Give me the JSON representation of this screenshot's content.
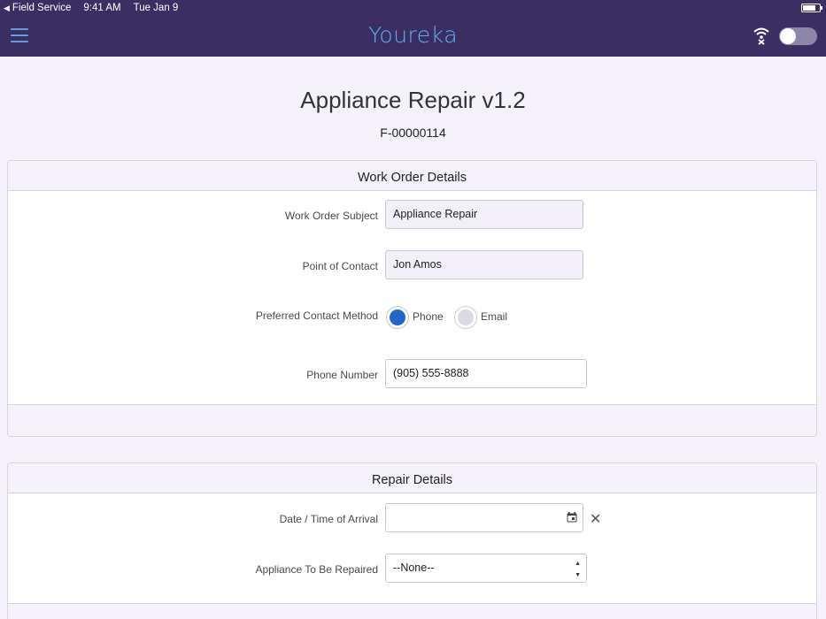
{
  "status_bar": {
    "back_app": "Field Service",
    "time": "9:41 AM",
    "date": "Tue Jan 9",
    "battery_level": 0.7
  },
  "nav": {
    "brand": "Youreka",
    "menu_icon": "hamburger-icon",
    "wifi_icon": "wifi-off-icon",
    "offline_toggle_on": false
  },
  "form": {
    "title": "Appliance Repair v1.2",
    "id": "F-00000114"
  },
  "work_order": {
    "header": "Work Order Details",
    "subject_label": "Work Order Subject",
    "subject_value": "Appliance Repair",
    "contact_label": "Point of Contact",
    "contact_value": "Jon Amos",
    "method_label": "Preferred Contact Method",
    "method_options": [
      "Phone",
      "Email"
    ],
    "method_selected": "Phone",
    "phone_label": "Phone Number",
    "phone_value": "(905) 555-8888"
  },
  "repair": {
    "header": "Repair Details",
    "arrival_label": "Date / Time of Arrival",
    "arrival_value": "",
    "clear_symbol": "✕",
    "appliance_label": "Appliance To Be Repaired",
    "appliance_value": "--None--"
  },
  "colors": {
    "nav_bg": "#3b2e63",
    "brand": "#5fb0ee",
    "radio_selected": "#1f68c9",
    "page_bg": "#f4f1fb"
  }
}
